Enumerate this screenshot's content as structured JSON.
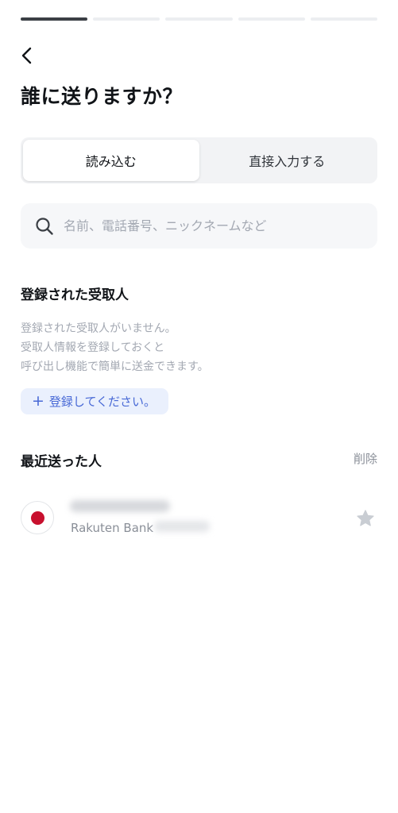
{
  "progress": {
    "total_steps": 5,
    "current_step": 1
  },
  "header": {
    "title": "誰に送りますか？"
  },
  "mode_tabs": [
    {
      "label": "読み込む",
      "active": true
    },
    {
      "label": "直接入力する",
      "active": false
    }
  ],
  "search": {
    "placeholder": "名前、電話番号、ニックネームなど",
    "value": ""
  },
  "registered": {
    "title": "登録された受取人",
    "empty_line1": "登録された受取人がいません。",
    "empty_line2": "受取人情報を登録しておくと",
    "empty_line3": "呼び出し機能で簡単に送金できます。",
    "register_label": "登録してください。"
  },
  "recent": {
    "title": "最近送った人",
    "delete_label": "削除",
    "items": [
      {
        "bank": "Rakuten Bank",
        "flag": "japan-flag-icon",
        "favorite": false
      }
    ]
  },
  "colors": {
    "accent": "#4869d6",
    "accent_bg": "#eaf0fd",
    "muted": "#a3a8b2",
    "flag_red": "#c8102e"
  }
}
